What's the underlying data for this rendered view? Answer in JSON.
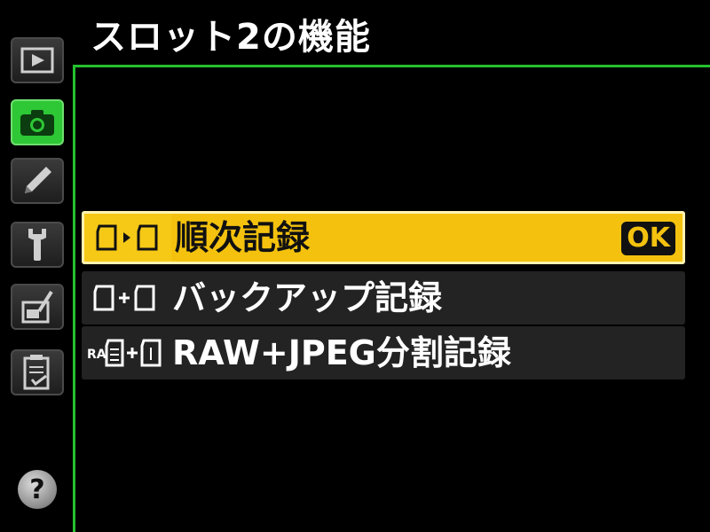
{
  "screen_title": "スロット2の機能",
  "tabs": [
    {
      "name": "playback",
      "icon": "play-icon",
      "active": false
    },
    {
      "name": "shooting",
      "icon": "camera-icon",
      "active": true
    },
    {
      "name": "custom",
      "icon": "pencil-icon",
      "active": false
    },
    {
      "name": "setup",
      "icon": "wrench-icon",
      "active": false
    },
    {
      "name": "retouch",
      "icon": "retouch-icon",
      "active": false
    },
    {
      "name": "my-menu",
      "icon": "recent-settings-icon",
      "active": false
    }
  ],
  "help_label": "?",
  "menu": {
    "items": [
      {
        "label": "順次記録",
        "icon": "overflow-icon",
        "selected": true
      },
      {
        "label": "バックアップ記録",
        "icon": "backup-icon",
        "selected": false
      },
      {
        "label": "RAW+JPEG分割記録",
        "icon": "raw-jpeg-icon",
        "selected": false
      }
    ],
    "ok_label": "OK"
  },
  "colors": {
    "accent_green": "#24c12e",
    "selected_yellow": "#f4c20e",
    "item_bg": "#232323",
    "background": "#000000"
  }
}
